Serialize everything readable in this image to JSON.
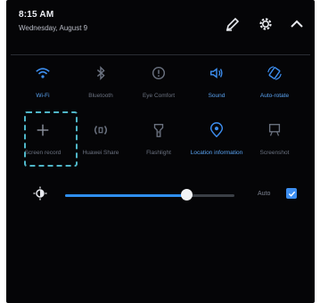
{
  "header": {
    "time": "8:15 AM",
    "date": "Wednesday, August 9",
    "edit_icon": "pencil-icon",
    "settings_icon": "gear-icon",
    "collapse_icon": "chevron-up-icon"
  },
  "tiles": [
    {
      "label": "Wi-Fi",
      "icon": "wifi-icon",
      "on": true
    },
    {
      "label": "Bluetooth",
      "icon": "bluetooth-icon",
      "on": false
    },
    {
      "label": "Eye Comfort",
      "icon": "eye-comfort-icon",
      "on": false
    },
    {
      "label": "Sound",
      "icon": "sound-icon",
      "on": true
    },
    {
      "label": "Auto-rotate",
      "icon": "auto-rotate-icon",
      "on": true
    },
    {
      "label": "Screen record",
      "icon": "plus-icon",
      "on": false
    },
    {
      "label": "Huawei Share",
      "icon": "huawei-share-icon",
      "on": false
    },
    {
      "label": "Flashlight",
      "icon": "flashlight-icon",
      "on": false
    },
    {
      "label": "Location information",
      "icon": "location-icon",
      "on": true
    },
    {
      "label": "Screenshot",
      "icon": "screenshot-icon",
      "on": false
    }
  ],
  "brightness": {
    "level": 0.72,
    "auto_label": "Auto",
    "auto_checked": true
  },
  "colors": {
    "accent": "#3d8ef0",
    "inactive": "#6b7280",
    "background": "#050507",
    "selection": "#4fb6c8"
  }
}
